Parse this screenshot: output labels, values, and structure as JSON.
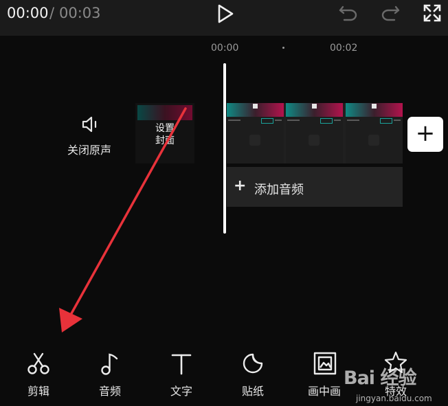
{
  "player": {
    "current_time": "00:00",
    "separator": "/",
    "total_time": "00:03"
  },
  "icons": {
    "play": "play-icon",
    "undo": "undo-icon",
    "redo": "redo-icon",
    "fullscreen": "fullscreen-icon"
  },
  "ruler": {
    "start": "00:00",
    "mark": "00:02"
  },
  "track_controls": {
    "mute_label": "关闭原声",
    "cover_label": "设置封面"
  },
  "timeline": {
    "add_audio_icon": "+",
    "add_audio_label": "添加音频",
    "add_clip_icon": "+"
  },
  "toolbar": {
    "items": [
      {
        "label": "剪辑",
        "icon": "scissors-icon"
      },
      {
        "label": "音频",
        "icon": "music-note-icon"
      },
      {
        "label": "文字",
        "icon": "text-icon"
      },
      {
        "label": "贴纸",
        "icon": "sticker-icon"
      },
      {
        "label": "画中画",
        "icon": "picture-in-picture-icon"
      },
      {
        "label": "特效",
        "icon": "effects-star-icon"
      }
    ]
  },
  "watermark": {
    "logo": "Bai 经验",
    "site": "jingyan.baidu.com"
  },
  "annotation_color": "#e8323a"
}
